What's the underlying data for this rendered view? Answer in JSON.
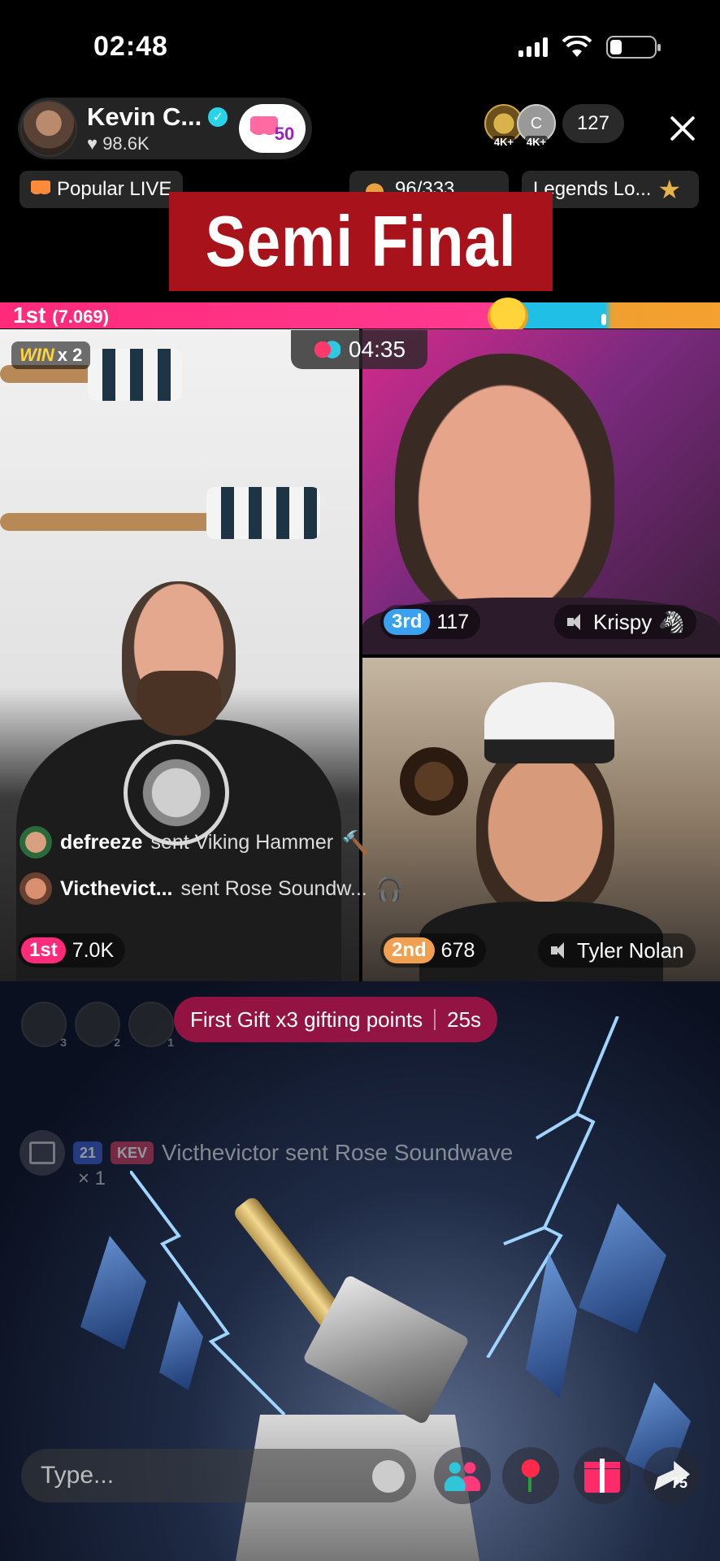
{
  "status_bar": {
    "time": "02:48"
  },
  "host": {
    "name": "Kevin C...",
    "likes": "98.6K",
    "badge_value": "50"
  },
  "viewers": {
    "count": "127",
    "avatar1_tag": "4K+",
    "avatar2_letter": "C",
    "avatar2_tag": "4K+"
  },
  "chips": {
    "popular": "Popular LIVE",
    "rank": "96/333",
    "legends": "Legends Lo..."
  },
  "banner": {
    "text": "Semi Final"
  },
  "battle": {
    "position": "1st",
    "score": "(7.069)",
    "timer": "04:35",
    "win_label": "WIN",
    "win_multiplier": "x 2"
  },
  "players": [
    {
      "rank": "1st",
      "score": "7.0K"
    },
    {
      "rank": "3rd",
      "score": "117",
      "name": "Krispy"
    },
    {
      "rank": "2nd",
      "score": "678",
      "name": "Tyler Nolan"
    }
  ],
  "gift_notices": [
    {
      "user": "defreeze",
      "action": "sent Viking Hammer"
    },
    {
      "user": "Victhevict...",
      "action": "sent Rose Soundw..."
    }
  ],
  "top_gifters": [
    "3",
    "2",
    "1"
  ],
  "first_gift": {
    "label": "First Gift x3 gifting points",
    "seconds": "25s"
  },
  "chat": {
    "level": "21",
    "fan_badge": "KEV",
    "text": "Victhevictor sent Rose Soundwave",
    "count": "× 1"
  },
  "input": {
    "placeholder": "Type..."
  },
  "share": {
    "count": "75"
  },
  "icons": [
    "heart-icon",
    "verified-icon",
    "close-icon",
    "gloves-icon",
    "mute-icon",
    "gift-icon",
    "emoji-icon",
    "multi-guest-icon",
    "rose-icon",
    "share-icon"
  ]
}
